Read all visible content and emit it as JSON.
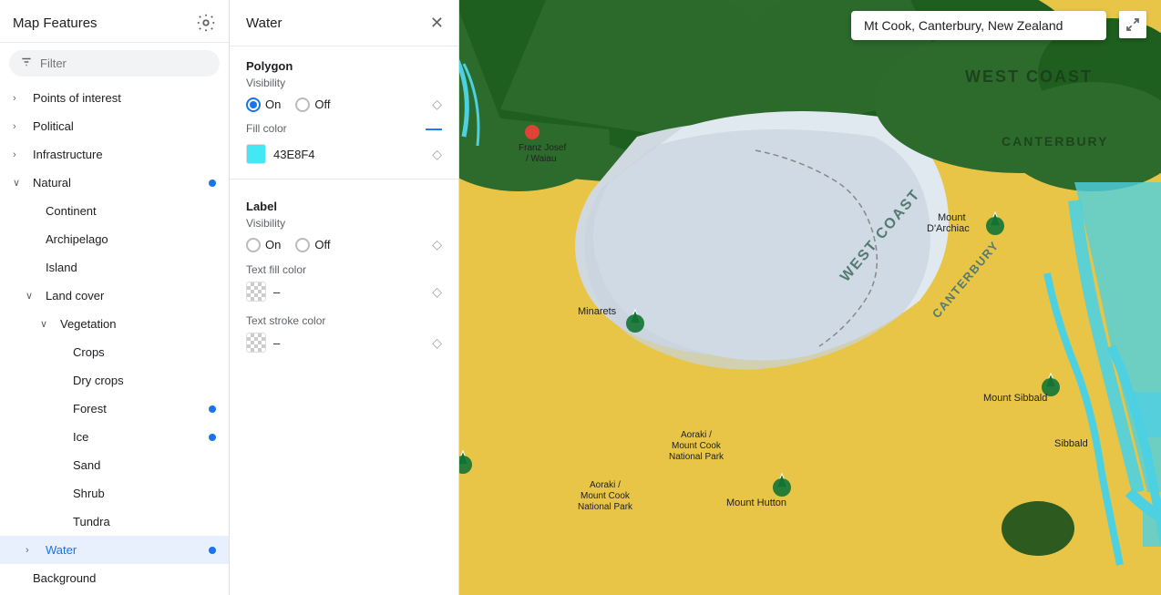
{
  "left_panel": {
    "title": "Map Features",
    "filter_placeholder": "Filter",
    "nav_items": [
      {
        "id": "points-of-interest",
        "label": "Points of interest",
        "indent": 0,
        "chevron": "right",
        "dot": false
      },
      {
        "id": "political",
        "label": "Political",
        "indent": 0,
        "chevron": "right",
        "dot": false
      },
      {
        "id": "infrastructure",
        "label": "Infrastructure",
        "indent": 0,
        "chevron": "right",
        "dot": false
      },
      {
        "id": "natural",
        "label": "Natural",
        "indent": 0,
        "chevron": "down",
        "dot": true
      },
      {
        "id": "continent",
        "label": "Continent",
        "indent": 1,
        "chevron": "",
        "dot": false
      },
      {
        "id": "archipelago",
        "label": "Archipelago",
        "indent": 1,
        "chevron": "",
        "dot": false
      },
      {
        "id": "island",
        "label": "Island",
        "indent": 1,
        "chevron": "",
        "dot": false
      },
      {
        "id": "land-cover",
        "label": "Land cover",
        "indent": 1,
        "chevron": "down",
        "dot": false
      },
      {
        "id": "vegetation",
        "label": "Vegetation",
        "indent": 2,
        "chevron": "down",
        "dot": false
      },
      {
        "id": "crops",
        "label": "Crops",
        "indent": 3,
        "chevron": "",
        "dot": false
      },
      {
        "id": "dry-crops",
        "label": "Dry crops",
        "indent": 3,
        "chevron": "",
        "dot": false
      },
      {
        "id": "forest",
        "label": "Forest",
        "indent": 3,
        "chevron": "",
        "dot": true
      },
      {
        "id": "ice",
        "label": "Ice",
        "indent": 3,
        "chevron": "",
        "dot": true
      },
      {
        "id": "sand",
        "label": "Sand",
        "indent": 3,
        "chevron": "",
        "dot": false
      },
      {
        "id": "shrub",
        "label": "Shrub",
        "indent": 3,
        "chevron": "",
        "dot": false
      },
      {
        "id": "tundra",
        "label": "Tundra",
        "indent": 3,
        "chevron": "",
        "dot": false
      },
      {
        "id": "water",
        "label": "Water",
        "indent": 1,
        "chevron": "right",
        "dot": true,
        "active": true
      },
      {
        "id": "background",
        "label": "Background",
        "indent": 0,
        "chevron": "",
        "dot": false
      }
    ]
  },
  "middle_panel": {
    "title": "Water",
    "polygon_section": "Polygon",
    "polygon_visibility_label": "Visibility",
    "polygon_on_label": "On",
    "polygon_off_label": "Off",
    "polygon_fill_color_label": "Fill color",
    "polygon_fill_color_value": "43E8F4",
    "polygon_fill_color_hex": "#43E8F4",
    "label_section": "Label",
    "label_visibility_label": "Visibility",
    "label_on_label": "On",
    "label_off_label": "Off",
    "text_fill_color_label": "Text fill color",
    "text_fill_color_value": "–",
    "text_stroke_color_label": "Text stroke color",
    "text_stroke_color_value": "–"
  },
  "map": {
    "search_value": "Mt Cook, Canterbury, New Zealand"
  }
}
